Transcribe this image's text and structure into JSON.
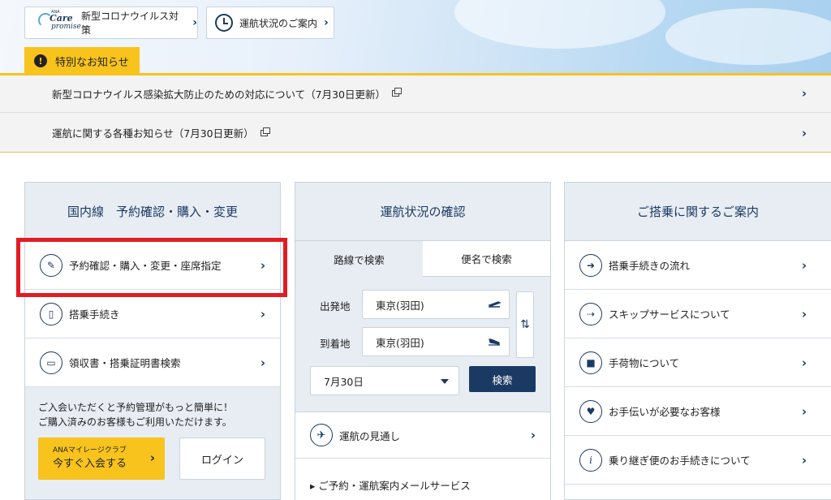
{
  "top_links": {
    "care_promise": {
      "logo_top": "ANA",
      "logo_care": "Care",
      "logo_promise": "promise",
      "label": "新型コロナウイルス対策"
    },
    "flight_status": {
      "label": "運航状況のご案内"
    }
  },
  "special_notice": {
    "tab_label": "特別なお知らせ",
    "items": [
      {
        "label": "新型コロナウイルス感染拡大防止のための対応について（7月30日更新）"
      },
      {
        "label": "運航に関する各種お知らせ（7月30日更新）"
      }
    ]
  },
  "domestic": {
    "title": "国内線　予約確認・購入・変更",
    "items": [
      {
        "label": "予約確認・購入・変更・座席指定",
        "icon": "edit-icon"
      },
      {
        "label": "搭乗手続き",
        "icon": "mobile-phone-icon"
      },
      {
        "label": "領収書・搭乗証明書検索",
        "icon": "receipt-icon"
      }
    ],
    "member_text_1": "ご入会いただくと予約管理がもっと簡単に！",
    "member_text_2": "ご購入済みのお客様もご利用いただけます。",
    "join_small": "ANAマイレージクラブ",
    "join_big": "今すぐ入会する",
    "login_label": "ログイン"
  },
  "status": {
    "title": "運航状況の確認",
    "tab_route": "路線で検索",
    "tab_flight": "便名で検索",
    "departure_label": "出発地",
    "departure_value": "東京(羽田)",
    "arrival_label": "到着地",
    "arrival_value": "東京(羽田)",
    "swap_glyph": "⇅",
    "date_value": "7月30日",
    "search_label": "検索",
    "outlook_label": "運航の見通し",
    "mail_label": "▸ ご予約・運航案内メールサービス"
  },
  "boarding": {
    "title": "ご搭乗に関するご案内",
    "items": [
      {
        "label": "搭乗手続きの流れ",
        "icon": "arrow-right-icon"
      },
      {
        "label": "スキップサービスについて",
        "icon": "skip-service-icon"
      },
      {
        "label": "手荷物について",
        "icon": "baggage-icon"
      },
      {
        "label": "お手伝いが必要なお客様",
        "icon": "heart-icon"
      },
      {
        "label": "乗り継ぎ便のお手続きについて",
        "icon": "info-icon"
      }
    ]
  },
  "colors": {
    "navy": "#1b3a63",
    "yellow": "#f7c31c",
    "highlight": "#e21c23",
    "panel": "#e8edf3"
  }
}
